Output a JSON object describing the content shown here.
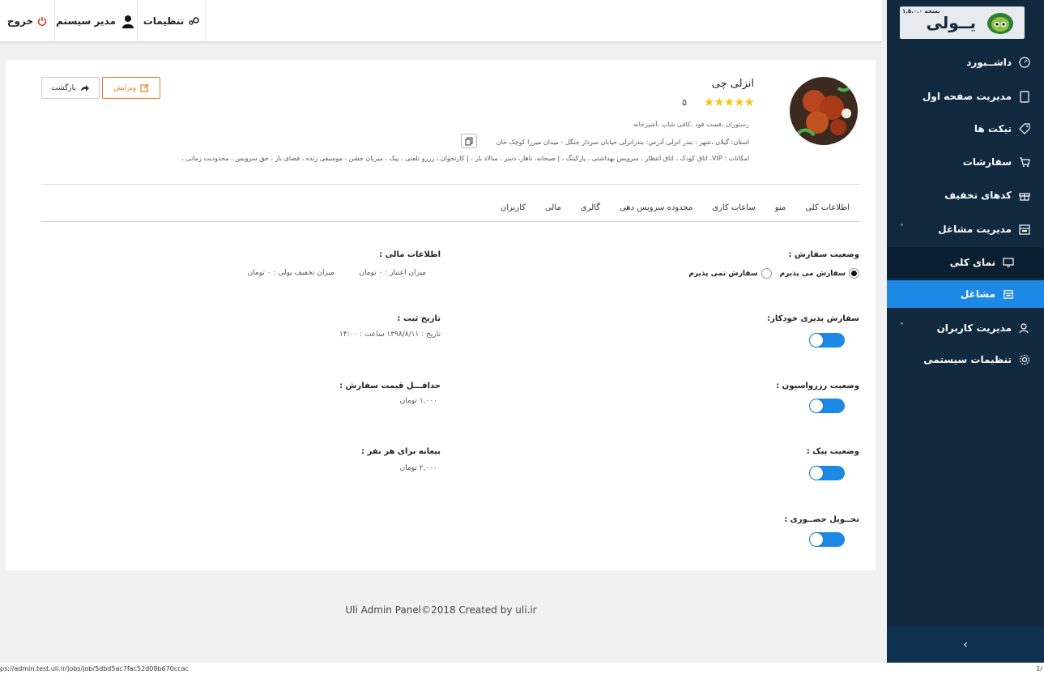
{
  "sidebar": {
    "logo_text": "یــولی",
    "version": "نسخه ۱.۵.۰.۰",
    "items": [
      {
        "label": "داشــبورد"
      },
      {
        "label": "مدیریت صفحه اول"
      },
      {
        "label": "تیکت ها"
      },
      {
        "label": "سفارشات"
      },
      {
        "label": "کدهای تخفیف"
      },
      {
        "label": "مدیریت مشاغل"
      },
      {
        "label": "نمای کلی"
      },
      {
        "label": "مشاغل"
      },
      {
        "label": "مدیریت کاربران"
      },
      {
        "label": "تنظیمات سیستمی"
      }
    ],
    "bottom_arrow": "›"
  },
  "topbar": {
    "settings": "تنظیمات",
    "admin": "مدیر سیستم",
    "logout": "خروج"
  },
  "business": {
    "name": "انزلی چی",
    "stars": "★★★★★",
    "rating": "۵",
    "categories": "رستوران ،فست فود ،کافی شاپ ،آشپزخانه",
    "address_line": "استان: گیلان  ،شهر : بندر انزلی   آدرس: بندرانزلی خیابان سردار جنگل - میدان میرزا کوچک خان",
    "amenities": "امکانات : VIP، اتاق کودک ، اتاق انتظار ، سرویس بهداشتی ، پارکینگ ، | صبحانه، ناهار، دسر ، سالاد بار ، | کارتخوان ، رزرو تلفنی ، پیک ، میزبان جشن ، موسیقی زنده ، فضای باز ، حق سرویس ، محدودیت زمانی ،"
  },
  "actions": {
    "edit": "ویرایش",
    "back": "بازگشت"
  },
  "tabs": [
    "اطلاعات کلی",
    "منو",
    "ساعات کاری",
    "محدوده سرویس دهی",
    "گالری",
    "مالی",
    "کاربران"
  ],
  "order_status": {
    "label": "وضعیت سفارش :",
    "accept": "سفارش می پذیرم",
    "reject": "سفارش نمی پذیرم"
  },
  "financial": {
    "label": "اطلاعات مالی :",
    "credit": "میزان اعتبار : ۰ تومان",
    "discount": "میزان تخفیف یولی : ۰ تومان"
  },
  "auto_order": {
    "label": "سفارش پذیری خودکار:"
  },
  "register_date": {
    "label": "تاریخ ثبت :",
    "value": "تاریخ :  ۱۳۹۸/۸/۱۱   ساعت :  ۱۴:۰۰"
  },
  "reservation": {
    "label": "وضعیت رزرواسیون :"
  },
  "min_price": {
    "label": "حداقـــل قیمت سفارش :",
    "value": "۱,۰۰۰ تومان"
  },
  "delivery": {
    "label": "وضعیت پیک :"
  },
  "deposit": {
    "label": "بیعانه برای هر نفر :",
    "value": "۲,۰۰۰ تومان"
  },
  "in_person": {
    "label": "تحــویل حضــوری :"
  },
  "footer": "Uli Admin Panel©2018 Created by uli.ir",
  "status": {
    "url": "ps://admin.test.uli.ir/jobs/job/5dbd5ac7fac52d08b670ccac",
    "page": "1/"
  },
  "colors": {
    "sidebar_bg": "#10293f",
    "active": "#1e88e5",
    "edit_accent": "#f47a20",
    "star": "#f5c518",
    "logout": "#e53935"
  }
}
